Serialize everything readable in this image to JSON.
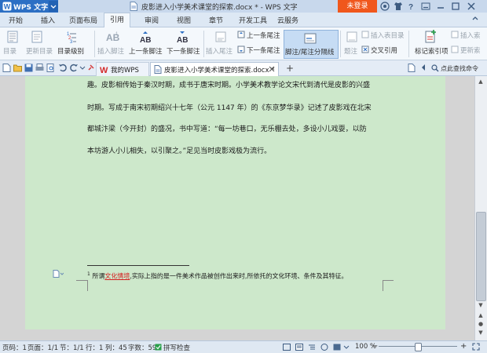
{
  "app": {
    "name": "WPS 文字",
    "doc_title": "皮影进入小学美术课堂的探索.docx * - WPS 文字",
    "login": "未登录"
  },
  "tabs": [
    "开始",
    "插入",
    "页面布局",
    "引用",
    "审阅",
    "视图",
    "章节",
    "开发工具",
    "云服务"
  ],
  "active_tab": "引用",
  "ribbon": {
    "toc": "目录",
    "update_toc": "更新目录",
    "toc_level": "目录级别",
    "insert_footnote": "插入脚注",
    "prev_footnote": "上一条脚注",
    "next_footnote": "下一条脚注",
    "insert_endnote": "插入尾注",
    "prev_endnote": "上一条尾注",
    "next_endnote": "下一条尾注",
    "separator_line": "脚注/尾注分隔线",
    "caption": "题注",
    "insert_table_of_figures": "插入表目录",
    "cross_reference": "交叉引用",
    "mark_index": "标记索引项",
    "insert_index": "插入索",
    "update_index": "更新索"
  },
  "doc_tabs": {
    "home": "我的WPS",
    "document": "皮影进入小学美术课堂的探索.docx *"
  },
  "search": {
    "label": "点此查找命令"
  },
  "document": {
    "lines": [
      "趣。皮影相传始于秦汉时期，成书于唐宋时期。小学美术教学论文宋代到清代是皮影的兴盛",
      "时期。写成于南宋初期绍兴十七年（公元 1147 年）的《东京梦华录》记述了皮影戏在北宋",
      "都城汴梁（今开封）的盛况，书中写道：“每一坊巷口，无乐棚去处，多设小儿戏耍，以防",
      "本坊游人小儿相失，以引聚之。”足见当时皮影戏极为流行。"
    ],
    "footnote": {
      "marker": "1",
      "prefix": "所谓",
      "highlight": "文化情境",
      "rest": ",实际上指的是一件美术作品被创作出来时,所依托的文化环境、条件及其特征。"
    }
  },
  "status": {
    "page": "页码：1",
    "pages": "页面：1/1",
    "section": "节：1/1",
    "row": "行：1",
    "col": "列：45",
    "words": "字数：594",
    "spell": "拼写检查",
    "zoom": "100 %",
    "zoom_percent": 50
  },
  "colors": {
    "page_bg": "#cde8cb",
    "accent": "#2c6fc4",
    "login": "#f0571c",
    "footnote_highlight": "#d42020"
  }
}
